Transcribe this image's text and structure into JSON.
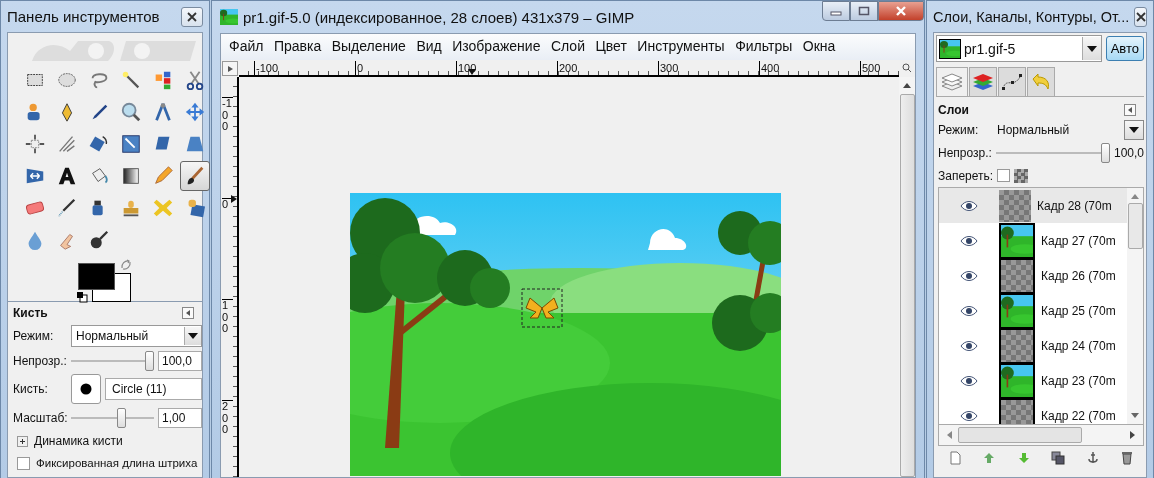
{
  "toolbox": {
    "title": "Панель инструментов",
    "tools": [
      {
        "selected": false
      },
      {
        "selected": false
      },
      {
        "selected": false
      },
      {
        "selected": false
      },
      {
        "selected": false
      },
      {
        "selected": false
      },
      {
        "selected": false
      },
      {
        "selected": false
      },
      {
        "selected": false
      },
      {
        "selected": false
      },
      {
        "selected": false
      },
      {
        "selected": false
      },
      {
        "selected": false
      },
      {
        "selected": false
      },
      {
        "selected": false
      },
      {
        "selected": false
      },
      {
        "selected": false
      },
      {
        "selected": false
      },
      {
        "selected": false
      },
      {
        "selected": false
      },
      {
        "selected": false
      },
      {
        "selected": false
      },
      {
        "selected": false
      },
      {
        "selected": true
      },
      {
        "selected": false
      },
      {
        "selected": false
      },
      {
        "selected": false
      },
      {
        "selected": false
      },
      {
        "selected": false
      },
      {
        "selected": false
      },
      {
        "selected": false
      },
      {
        "selected": false
      },
      {
        "selected": false
      }
    ]
  },
  "tool_options": {
    "title": "Кисть",
    "mode_label": "Режим:",
    "mode": "Нормальный",
    "opacity_label": "Непрозр.:",
    "opacity": {
      "level": 1.0
    },
    "opacity_value": "100,0",
    "brush_label": "Кисть:",
    "brush": "Circle (11)",
    "scale_label": "Масштаб:",
    "scale": {
      "level": 0.62
    },
    "scale_value": "1,00",
    "dynamics": {
      "label": "Динамика кисти",
      "expanded": false
    },
    "fixed_length": {
      "label": "Фиксированная длина штриха",
      "checked": false
    }
  },
  "image_window": {
    "title": "pr1.gif-5.0 (индексированное, 28 слоев) 431x379 – GIMP",
    "menu": [
      "Файл",
      "Правка",
      "Выделение",
      "Вид",
      "Изображение",
      "Слой",
      "Цвет",
      "Инструменты",
      "Фильтры",
      "Окна"
    ],
    "h_ruler": [
      "-100",
      "0",
      "100",
      "200",
      "300",
      "400",
      "500"
    ],
    "v_ruler": [
      "-100",
      "0",
      "100",
      "200"
    ]
  },
  "layers_dock": {
    "title": "Слои, Каналы, Контуры, От...",
    "image": "pr1.gif-5",
    "auto_button": "Авто",
    "tabs": [
      {
        "selected": true
      },
      {
        "selected": false
      },
      {
        "selected": false
      },
      {
        "selected": false
      }
    ],
    "heading": "Слои",
    "mode_label": "Режим:",
    "mode": "Нормальный",
    "opacity_label": "Непрозр.:",
    "opacity": {
      "level": 1.0
    },
    "opacity_value": "100,0",
    "lock_label": "Запереть:",
    "lock_checked": false,
    "layers": [
      {
        "name": "Кадр 28 (70m",
        "visible": true,
        "kind": "transparent",
        "selected": true
      },
      {
        "name": "Кадр 27 (70m",
        "visible": true,
        "kind": "scene",
        "selected": false
      },
      {
        "name": "Кадр 26 (70m",
        "visible": true,
        "kind": "transparent",
        "selected": false
      },
      {
        "name": "Кадр 25 (70m",
        "visible": true,
        "kind": "scene",
        "selected": false
      },
      {
        "name": "Кадр 24 (70m",
        "visible": true,
        "kind": "transparent",
        "selected": false
      },
      {
        "name": "Кадр 23 (70m",
        "visible": true,
        "kind": "scene",
        "selected": false
      },
      {
        "name": "Кадр 22 (70m",
        "visible": true,
        "kind": "transparent",
        "selected": false
      }
    ]
  }
}
